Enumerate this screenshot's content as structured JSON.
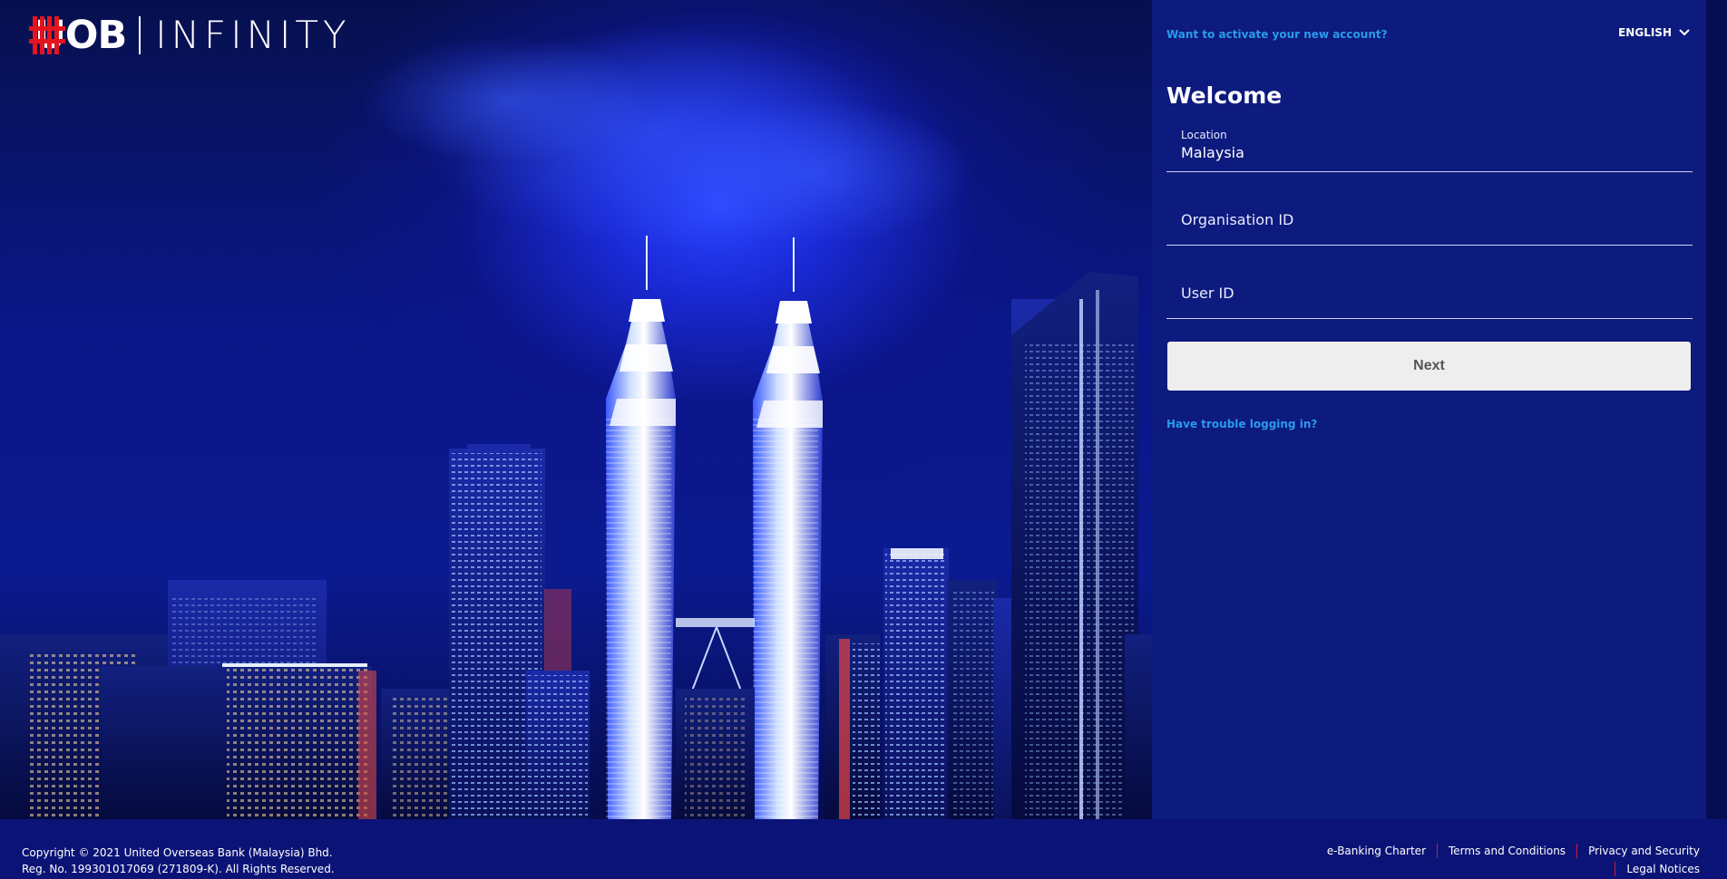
{
  "brand": {
    "name": "UOB",
    "product": "INFINITY",
    "mark_color": "#e4141e"
  },
  "header": {
    "activate_link": "Want to activate your new account?",
    "language": "ENGLISH"
  },
  "login": {
    "title": "Welcome",
    "location": {
      "label": "Location",
      "value": "Malaysia"
    },
    "organisation_id": {
      "placeholder": "Organisation ID"
    },
    "user_id": {
      "placeholder": "User ID"
    },
    "next_label": "Next",
    "trouble_link": "Have trouble logging in?"
  },
  "footer": {
    "copyright": "Copyright © 2021 United Overseas Bank (Malaysia) Bhd.",
    "registration": "Reg. No. 199301017069 (271809-K). All Rights Reserved.",
    "links": [
      "e-Banking Charter",
      "Terms and Conditions",
      "Privacy and Security"
    ],
    "legal": "Legal Notices"
  },
  "colors": {
    "panel_bg": "#0d1a7e",
    "link": "#2a9bea",
    "footer_divider": "#d6173a",
    "button_bg": "#eeeeee"
  }
}
